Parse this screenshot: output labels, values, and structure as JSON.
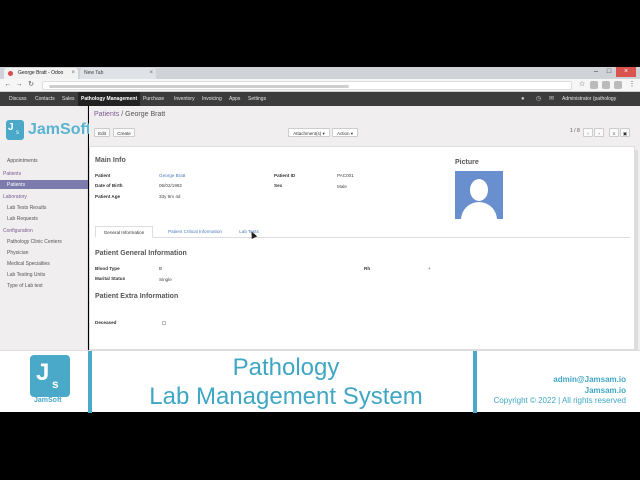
{
  "browser": {
    "tabs": [
      {
        "label": "George Bratt - Odoo"
      },
      {
        "label": "New Tab"
      }
    ]
  },
  "topmenu": {
    "items": [
      "Discuss",
      "Contacts",
      "Sales",
      "Pathology Management",
      "Purchase",
      "Inventory",
      "Invoicing",
      "Apps",
      "Settings"
    ],
    "active": "Pathology Management",
    "user": "Administrator (pathology"
  },
  "sidebar": {
    "brand": "JamSoft",
    "logo_j": "J",
    "logo_s": "s",
    "items": {
      "appointments": "Appointments",
      "patients_head": "Patients",
      "patients": "Patients",
      "laboratory_head": "Laboratory",
      "lab_tests_results": "Lab Tests Results",
      "lab_requests": "Lab Requests",
      "configuration_head": "Configuration",
      "pathology_clinic_centers": "Pathology Clinic Centers",
      "physician": "Physician",
      "medical_specialties": "Medical Specialties",
      "lab_testing_units": "Lab Testing Units",
      "type_of_lab_test": "Type of Lab test"
    }
  },
  "breadcrumb": {
    "parent": "Patients",
    "separator": "/",
    "current": "George Bratt"
  },
  "controls": {
    "edit": "Edit",
    "create": "Create",
    "attachments": "Attachment(s) ▾",
    "action": "Action ▾",
    "pager": "1 / 8"
  },
  "form": {
    "main_info": "Main Info",
    "picture": "Picture",
    "patient_label": "Patient",
    "patient_value": "George Bratt",
    "dob_label": "Date of Birth",
    "dob_value": "06/02/1982",
    "age_label": "Patient Age",
    "age_value": "33y 9m 4d",
    "patient_id_label": "Patient ID",
    "patient_id_value": "PAC001",
    "sex_label": "Sex",
    "sex_value": "Male",
    "tabs": [
      "General Information",
      "Patient Critical Information",
      "Lab Tests"
    ],
    "active_tab": "General Information",
    "general_heading": "Patient General Information",
    "blood_type_label": "Blood Type",
    "blood_type_value": "B",
    "rh_label": "Rh",
    "rh_value": "+",
    "marital_label": "Marital Status",
    "marital_value": "Single",
    "extra_heading": "Patient Extra Information",
    "deceased_label": "Deceased",
    "deceased_checked": false
  },
  "banner": {
    "logo_j": "J",
    "logo_s": "s",
    "logo_text": "JamSoft",
    "title_line1": "Pathology",
    "title_line2": "Lab Management System",
    "email": "admin@Jamsam.io",
    "site": "Jamsam.io",
    "copyright": "Copyright © 2022 | All rights reserved"
  },
  "colors": {
    "accent": "#7c7bad",
    "brand": "#4aa8c8",
    "topbar": "#3c3c3c",
    "link": "#4a7ab8"
  }
}
